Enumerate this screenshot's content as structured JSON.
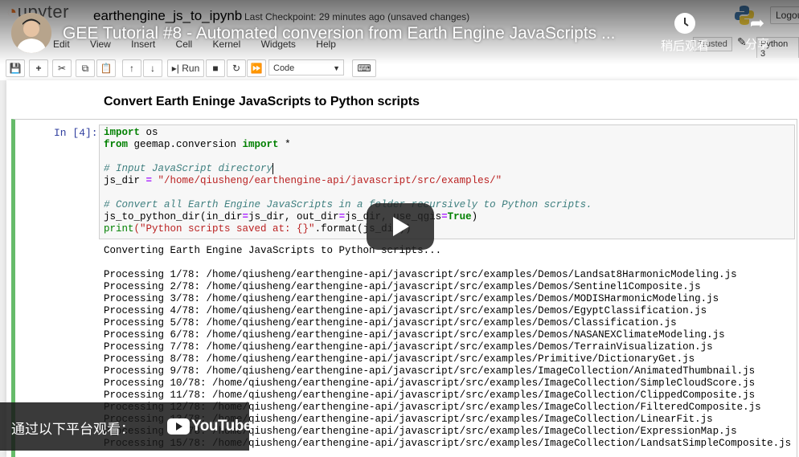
{
  "jupyter": {
    "logo_text": "upyter",
    "notebook_name": "earthengine_js_to_ipynb",
    "checkpoint": "Last Checkpoint: 29 minutes ago  (unsaved changes)",
    "logout_label": "Logou",
    "menu": [
      "Edit",
      "View",
      "Insert",
      "Cell",
      "Kernel",
      "Widgets",
      "Help"
    ],
    "trusted_label": "Trusted",
    "kernel_label": "Python 3",
    "toolbar": {
      "run_label": "Run",
      "cell_type": "Code"
    }
  },
  "video": {
    "title": "GEE Tutorial #8 - Automated conversion from Earth Engine JavaScripts ...",
    "watch_later_label": "稍后观看",
    "share_label": "分享",
    "watch_on_label": "通过以下平台观看：",
    "youtube_label": "YouTube",
    "play_icon": "play-icon"
  },
  "notebook": {
    "heading": "Convert Earth Eninge JavaScripts to Python scripts",
    "prompt": "In [4]:",
    "code": {
      "l1_kw": "import",
      "l1_rest": " os",
      "l2_kw1": "from",
      "l2_mid": " geemap.conversion ",
      "l2_kw2": "import",
      "l2_rest": " *",
      "l3_comment": "# Input JavaScript directory",
      "l4_var": "js_dir ",
      "l4_op": "=",
      "l4_str": " \"/home/qiusheng/earthengine-api/javascript/src/examples/\"",
      "l5_comment": "# Convert all Earth Engine JavaScripts in a folder recursively to Python scripts.",
      "l6_a": "js_to_python_dir(in_dir",
      "l6_op1": "=",
      "l6_b": "js_dir, out_dir",
      "l6_op2": "=",
      "l6_c": "js_dir, use_qgis",
      "l6_op3": "=",
      "l6_true": "True",
      "l6_d": ")",
      "l7_print": "print",
      "l7_str": "(\"Python scripts saved at: {}\"",
      "l7_rest": ".format(js_dir))"
    },
    "output_first": "Converting Earth Engine JavaScripts to Python scripts...",
    "output_lines": [
      "Processing 1/78: /home/qiusheng/earthengine-api/javascript/src/examples/Demos/Landsat8HarmonicModeling.js",
      "Processing 2/78: /home/qiusheng/earthengine-api/javascript/src/examples/Demos/Sentinel1Composite.js",
      "Processing 3/78: /home/qiusheng/earthengine-api/javascript/src/examples/Demos/MODISHarmonicModeling.js",
      "Processing 4/78: /home/qiusheng/earthengine-api/javascript/src/examples/Demos/EgyptClassification.js",
      "Processing 5/78: /home/qiusheng/earthengine-api/javascript/src/examples/Demos/Classification.js",
      "Processing 6/78: /home/qiusheng/earthengine-api/javascript/src/examples/Demos/NASANEXClimateModeling.js",
      "Processing 7/78: /home/qiusheng/earthengine-api/javascript/src/examples/Demos/TerrainVisualization.js",
      "Processing 8/78: /home/qiusheng/earthengine-api/javascript/src/examples/Primitive/DictionaryGet.js",
      "Processing 9/78: /home/qiusheng/earthengine-api/javascript/src/examples/ImageCollection/AnimatedThumbnail.js",
      "Processing 10/78: /home/qiusheng/earthengine-api/javascript/src/examples/ImageCollection/SimpleCloudScore.js",
      "Processing 11/78: /home/qiusheng/earthengine-api/javascript/src/examples/ImageCollection/ClippedComposite.js",
      "Processing 12/78: /home/qiusheng/earthengine-api/javascript/src/examples/ImageCollection/FilteredComposite.js",
      "Processing 13/78: /home/qiusheng/earthengine-api/javascript/src/examples/ImageCollection/LinearFit.js",
      "Processing 14/78: /home/qiusheng/earthengine-api/javascript/src/examples/ImageCollection/ExpressionMap.js",
      "Processing 15/78: /home/qiusheng/earthengine-api/javascript/src/examples/ImageCollection/LandsatSimpleComposite.js"
    ]
  }
}
